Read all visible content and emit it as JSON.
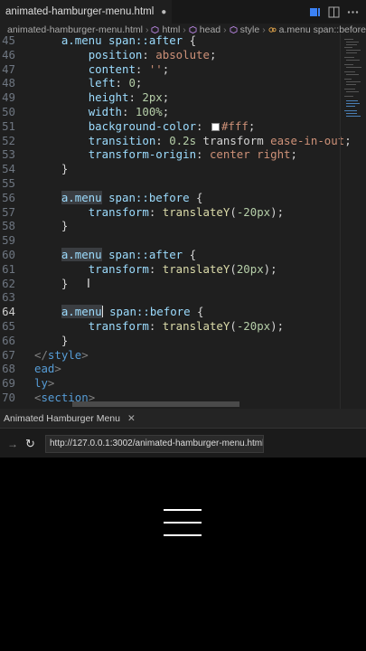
{
  "editor": {
    "tab_label": "animated-hamburger-menu.html",
    "breadcrumb": [
      "animated-hamburger-menu.html",
      "html",
      "head",
      "style",
      "a.menu span::before"
    ],
    "lines": [
      {
        "n": "45",
        "parts": [
          [
            "    ",
            ""
          ],
          [
            "a.menu span::after",
            "sel"
          ],
          [
            " {",
            "punc"
          ]
        ]
      },
      {
        "n": "46",
        "parts": [
          [
            "        ",
            ""
          ],
          [
            "position",
            "prop"
          ],
          [
            ": ",
            "punc"
          ],
          [
            "absolute",
            "val"
          ],
          [
            ";",
            "punc"
          ]
        ]
      },
      {
        "n": "47",
        "parts": [
          [
            "        ",
            ""
          ],
          [
            "content",
            "prop"
          ],
          [
            ": ",
            "punc"
          ],
          [
            "''",
            "val"
          ],
          [
            ";",
            "punc"
          ]
        ]
      },
      {
        "n": "48",
        "parts": [
          [
            "        ",
            ""
          ],
          [
            "left",
            "prop"
          ],
          [
            ": ",
            "punc"
          ],
          [
            "0",
            "num"
          ],
          [
            ";",
            "punc"
          ]
        ]
      },
      {
        "n": "49",
        "parts": [
          [
            "        ",
            ""
          ],
          [
            "height",
            "prop"
          ],
          [
            ": ",
            "punc"
          ],
          [
            "2px",
            "num"
          ],
          [
            ";",
            "punc"
          ]
        ]
      },
      {
        "n": "50",
        "parts": [
          [
            "        ",
            ""
          ],
          [
            "width",
            "prop"
          ],
          [
            ": ",
            "punc"
          ],
          [
            "100%",
            "num"
          ],
          [
            ";",
            "punc"
          ]
        ]
      },
      {
        "n": "51",
        "parts": [
          [
            "        ",
            ""
          ],
          [
            "background-color",
            "prop"
          ],
          [
            ": ",
            "punc"
          ],
          [
            "#swatch",
            "swatch"
          ],
          [
            "#fff",
            "val"
          ],
          [
            ";",
            "punc"
          ]
        ]
      },
      {
        "n": "52",
        "parts": [
          [
            "        ",
            ""
          ],
          [
            "transition",
            "prop"
          ],
          [
            ": ",
            "punc"
          ],
          [
            "0.2s",
            "num"
          ],
          [
            " transform ",
            "punc"
          ],
          [
            "ease-in-out",
            "val"
          ],
          [
            ";",
            "punc"
          ]
        ]
      },
      {
        "n": "53",
        "parts": [
          [
            "        ",
            ""
          ],
          [
            "transform-origin",
            "prop"
          ],
          [
            ": ",
            "punc"
          ],
          [
            "center right",
            "val"
          ],
          [
            ";",
            "punc"
          ]
        ]
      },
      {
        "n": "54",
        "parts": [
          [
            "    ",
            ""
          ],
          [
            "}",
            "punc"
          ]
        ]
      },
      {
        "n": "55",
        "parts": []
      },
      {
        "n": "56",
        "parts": [
          [
            "    ",
            ""
          ],
          [
            "a.menu",
            "sel hl"
          ],
          [
            " span::before",
            "sel"
          ],
          [
            " {",
            "punc"
          ]
        ]
      },
      {
        "n": "57",
        "parts": [
          [
            "        ",
            ""
          ],
          [
            "transform",
            "prop"
          ],
          [
            ": ",
            "punc"
          ],
          [
            "translateY",
            "fn"
          ],
          [
            "(",
            "punc"
          ],
          [
            "-20px",
            "num"
          ],
          [
            ");",
            "punc"
          ]
        ]
      },
      {
        "n": "58",
        "parts": [
          [
            "    ",
            ""
          ],
          [
            "}",
            "punc"
          ]
        ]
      },
      {
        "n": "59",
        "parts": []
      },
      {
        "n": "60",
        "parts": [
          [
            "    ",
            ""
          ],
          [
            "a.menu",
            "sel hl"
          ],
          [
            " span::after",
            "sel"
          ],
          [
            " {",
            "punc"
          ]
        ]
      },
      {
        "n": "61",
        "parts": [
          [
            "        ",
            ""
          ],
          [
            "transform",
            "prop"
          ],
          [
            ": ",
            "punc"
          ],
          [
            "translateY",
            "fn"
          ],
          [
            "(",
            "punc"
          ],
          [
            "20px",
            "num"
          ],
          [
            ");",
            "punc"
          ]
        ]
      },
      {
        "n": "62",
        "parts": [
          [
            "    ",
            ""
          ],
          [
            "}",
            "punc"
          ]
        ]
      },
      {
        "n": "63",
        "parts": []
      },
      {
        "n": "64",
        "cur": true,
        "parts": [
          [
            "    ",
            ""
          ],
          [
            "a.menu",
            "sel hl"
          ],
          [
            "#caret",
            "caret"
          ],
          [
            " span::before",
            "sel"
          ],
          [
            " {",
            "punc"
          ]
        ]
      },
      {
        "n": "65",
        "parts": [
          [
            "        ",
            ""
          ],
          [
            "transform",
            "prop"
          ],
          [
            ": ",
            "punc"
          ],
          [
            "translateY",
            "fn"
          ],
          [
            "(",
            "punc"
          ],
          [
            "-20px",
            "num"
          ],
          [
            ");",
            "punc"
          ]
        ]
      },
      {
        "n": "66",
        "parts": [
          [
            "    ",
            ""
          ],
          [
            "}",
            "punc"
          ]
        ]
      },
      {
        "n": "67",
        "parts": [
          [
            "",
            ""
          ],
          [
            "</",
            "ang"
          ],
          [
            "style",
            "tag"
          ],
          [
            ">",
            "ang"
          ]
        ]
      },
      {
        "n": "68",
        "parts": [
          [
            "",
            ""
          ],
          [
            "ead",
            "tag"
          ],
          [
            ">",
            "ang"
          ]
        ]
      },
      {
        "n": "69",
        "parts": [
          [
            "",
            ""
          ],
          [
            "ly",
            "tag"
          ],
          [
            ">",
            "ang"
          ]
        ]
      },
      {
        "n": "70",
        "parts": [
          [
            "",
            ""
          ],
          [
            "<",
            "ang"
          ],
          [
            "section",
            "tag"
          ],
          [
            ">",
            "ang"
          ]
        ]
      }
    ]
  },
  "browser": {
    "tab_title": "Animated Hamburger Menu",
    "url": "http://127.0.0.1:3002/animated-hamburger-menu.html"
  },
  "colors": {
    "editor_bg": "#1f1f1f",
    "page_bg": "#000000",
    "menu_lines": "#ffffff"
  }
}
